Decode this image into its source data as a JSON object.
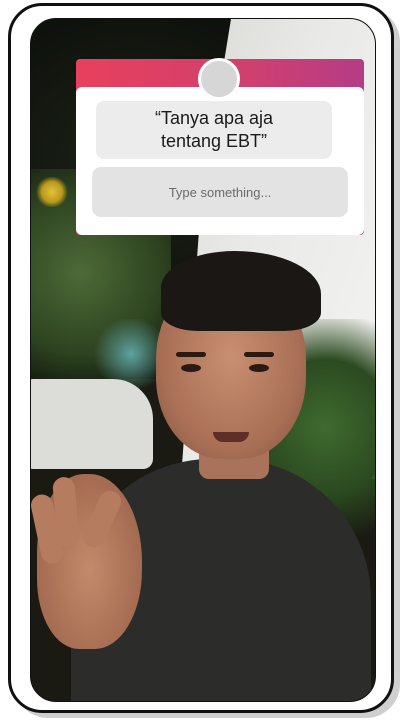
{
  "question_sticker": {
    "question": "“Tanya apa aja tentang EBT”",
    "answer_placeholder": "Type something...",
    "gradient_colors": [
      "#e8405d",
      "#b53c86"
    ]
  },
  "icons": {
    "avatar": "profile-avatar-icon"
  }
}
